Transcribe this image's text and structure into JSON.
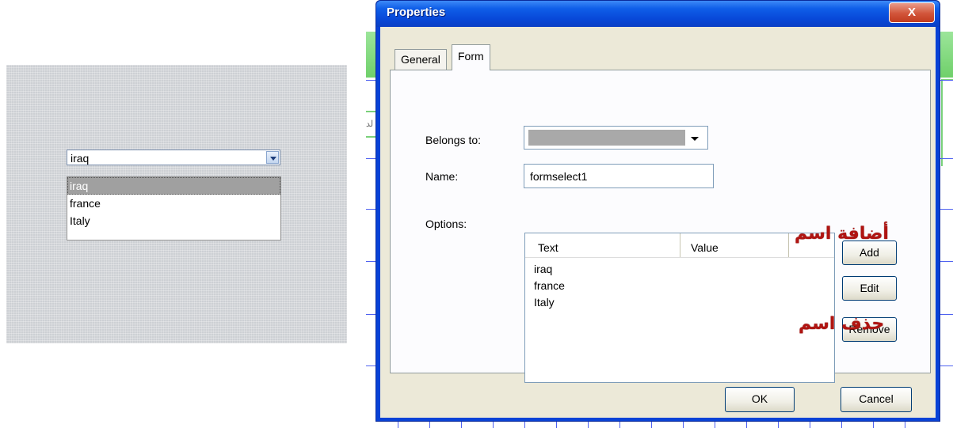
{
  "preview": {
    "combo_value": "iraq",
    "list_items": [
      "iraq",
      "france",
      "Italy"
    ],
    "selected_index": 0
  },
  "dialog": {
    "title": "Properties",
    "close_label": "X",
    "tabs": [
      {
        "label": "General",
        "active": false
      },
      {
        "label": "Form",
        "active": true
      }
    ],
    "fields": {
      "belongs_to_label": "Belongs to:",
      "belongs_to_value": "",
      "name_label": "Name:",
      "name_value": "formselect1",
      "options_label": "Options:"
    },
    "options_table": {
      "columns": [
        "Text",
        "Value"
      ],
      "rows": [
        "iraq",
        "france",
        "Italy"
      ]
    },
    "buttons": {
      "add": "Add",
      "edit": "Edit",
      "remove": "Remove",
      "ok": "OK",
      "cancel": "Cancel"
    },
    "annotations": {
      "add_note": "أضافة اسم",
      "remove_note": "حذف اسم"
    }
  },
  "background": {
    "side_text": "لد"
  },
  "colors": {
    "titlebar": "#0842d6",
    "close_button": "#d2553a",
    "dialog_body": "#ece9d8",
    "annotation": "#b01512",
    "editor_green": "#8ee08a",
    "editor_grid": "#4f62f0"
  }
}
